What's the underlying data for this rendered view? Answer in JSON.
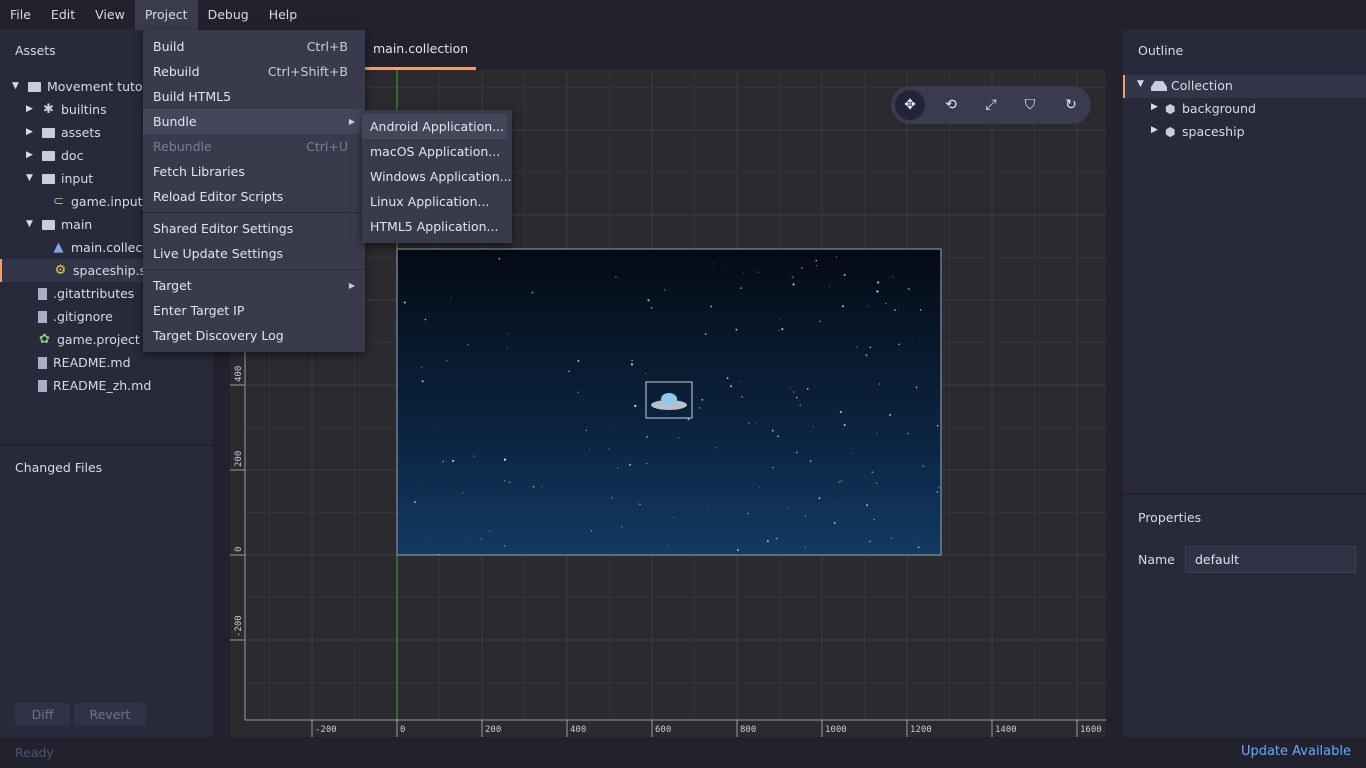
{
  "menubar": {
    "items": [
      "File",
      "Edit",
      "View",
      "Project",
      "Debug",
      "Help"
    ],
    "active": "Project"
  },
  "assets": {
    "title": "Assets",
    "items": [
      {
        "label": "Movement tutorial",
        "type": "folder",
        "expanded": true,
        "depth": 0
      },
      {
        "label": "builtins",
        "type": "puzzle",
        "expanded": false,
        "depth": 1
      },
      {
        "label": "assets",
        "type": "folder",
        "expanded": false,
        "depth": 1
      },
      {
        "label": "doc",
        "type": "folder",
        "expanded": false,
        "depth": 1
      },
      {
        "label": "input",
        "type": "folder",
        "expanded": true,
        "depth": 1
      },
      {
        "label": "game.input_binding",
        "type": "input",
        "depth": 2
      },
      {
        "label": "main",
        "type": "folder",
        "expanded": true,
        "depth": 1
      },
      {
        "label": "main.collection",
        "type": "collection",
        "depth": 2
      },
      {
        "label": "spaceship.script",
        "type": "script",
        "depth": 2,
        "selected": true
      },
      {
        "label": ".gitattributes",
        "type": "file",
        "depth": 1
      },
      {
        "label": ".gitignore",
        "type": "file",
        "depth": 1
      },
      {
        "label": "game.project",
        "type": "project",
        "depth": 1
      },
      {
        "label": "README.md",
        "type": "file",
        "depth": 1
      },
      {
        "label": "README_zh.md",
        "type": "file",
        "depth": 1
      }
    ]
  },
  "changed_files": {
    "title": "Changed Files",
    "diff_label": "Diff",
    "revert_label": "Revert"
  },
  "status": {
    "text": "Ready",
    "update": "Update Available"
  },
  "editor": {
    "tab_label": "main.collection",
    "tab_close": "✕",
    "x_ticks": [
      "-200",
      "0",
      "200",
      "400",
      "600",
      "800",
      "1000",
      "1200",
      "1400",
      "1600"
    ],
    "y_ticks": [
      "-200",
      "0",
      "200",
      "400"
    ]
  },
  "toolbar": {
    "tools": [
      "move-tool",
      "rotate-tool",
      "scale-tool",
      "perspective-tool",
      "camera-reset-tool"
    ],
    "active": "move-tool"
  },
  "project_menu": {
    "items": [
      {
        "label": "Build",
        "shortcut": "Ctrl+B"
      },
      {
        "label": "Rebuild",
        "shortcut": "Ctrl+Shift+B"
      },
      {
        "label": "Build HTML5",
        "shortcut": ""
      },
      {
        "label": "Bundle",
        "shortcut": "",
        "submenu": true,
        "highlighted": true
      },
      {
        "label": "Rebundle",
        "shortcut": "Ctrl+U",
        "disabled": true
      },
      {
        "label": "Fetch Libraries",
        "shortcut": ""
      },
      {
        "label": "Reload Editor Scripts",
        "shortcut": ""
      },
      {
        "label": "Shared Editor Settings",
        "shortcut": ""
      },
      {
        "label": "Live Update Settings",
        "shortcut": ""
      },
      {
        "label": "Target",
        "shortcut": "",
        "submenu": true
      },
      {
        "label": "Enter Target IP",
        "shortcut": ""
      },
      {
        "label": "Target Discovery Log",
        "shortcut": ""
      }
    ]
  },
  "bundle_submenu": {
    "items": [
      "Android Application...",
      "macOS Application...",
      "Windows Application...",
      "Linux Application...",
      "HTML5 Application..."
    ],
    "highlighted": 0
  },
  "outline": {
    "title": "Outline",
    "items": [
      {
        "label": "Collection",
        "depth": 0,
        "expanded": true
      },
      {
        "label": "background",
        "depth": 1
      },
      {
        "label": "spaceship",
        "depth": 1
      }
    ]
  },
  "properties": {
    "title": "Properties",
    "name_label": "Name",
    "name_value": "default"
  },
  "colors": {
    "accent": "#f0a070",
    "y_axis": "#3fae2a",
    "link": "#6aa8ff"
  }
}
